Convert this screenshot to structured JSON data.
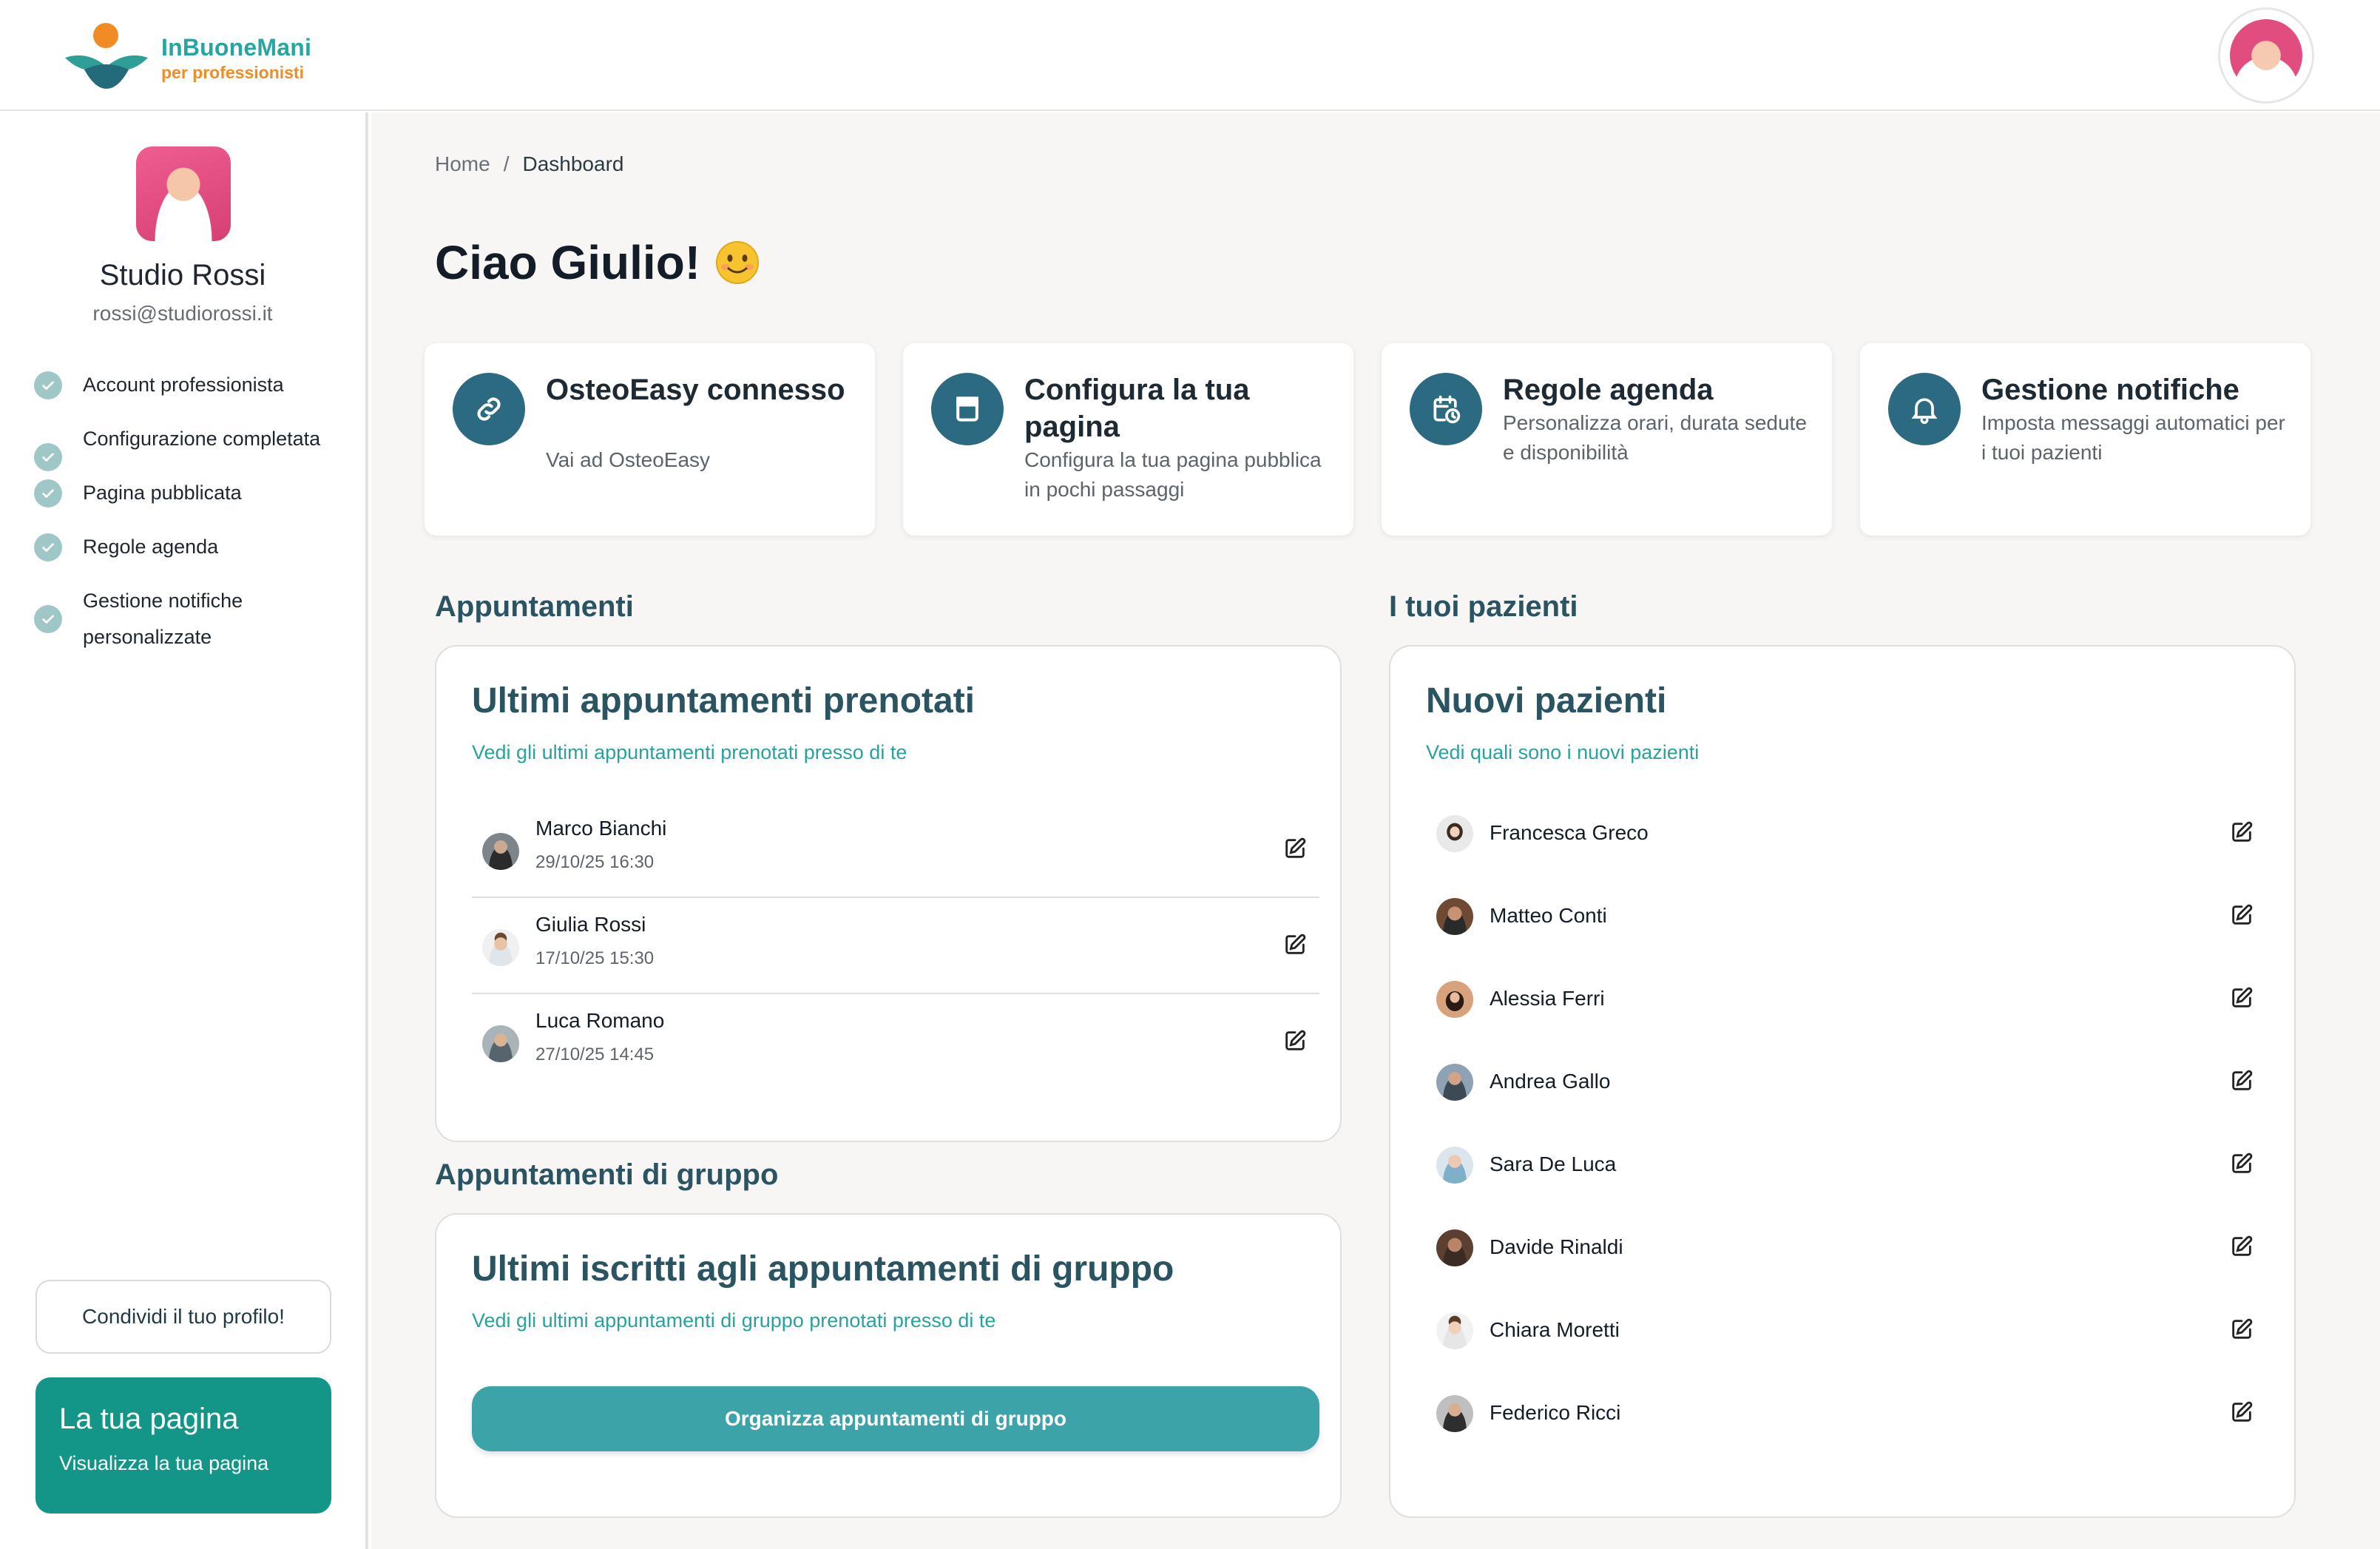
{
  "brand": {
    "name": "InBuoneMani",
    "tagline": "per professionisti"
  },
  "sidebar": {
    "name": "Studio Rossi",
    "email": "rossi@studiorossi.it",
    "checklist": [
      {
        "label": "Account professionista",
        "done": true
      },
      {
        "label": "Configurazione completata",
        "done": true
      },
      {
        "label": "Pagina pubblicata",
        "done": true
      },
      {
        "label": "Regole agenda",
        "done": true
      },
      {
        "label": "Gestione notifiche personalizzate",
        "done": true
      }
    ],
    "share_label": "Condividi il tuo profilo!",
    "page_card": {
      "title": "La tua pagina",
      "subtitle": "Visualizza la tua pagina"
    }
  },
  "breadcrumb": {
    "home": "Home",
    "separator": "/",
    "current": "Dashboard"
  },
  "greeting": "Ciao Giulio!",
  "tiles": [
    {
      "title": "OsteoEasy connesso",
      "subtitle": "Vai ad OsteoEasy",
      "icon": "link-icon"
    },
    {
      "title": "Configura la tua pagina",
      "subtitle": "Configura la tua pagina pubblica in pochi passaggi",
      "icon": "page-icon"
    },
    {
      "title": "Regole agenda",
      "subtitle": "Personalizza orari, durata sedute e disponibilità",
      "icon": "calendar-clock-icon"
    },
    {
      "title": "Gestione notifiche",
      "subtitle": "Imposta messaggi automatici per i tuoi pazienti",
      "icon": "bell-icon"
    }
  ],
  "appointments": {
    "section_title": "Appuntamenti",
    "card_title": "Ultimi appuntamenti prenotati",
    "card_subtitle": "Vedi gli ultimi appuntamenti prenotati presso di te",
    "items": [
      {
        "name": "Marco Bianchi",
        "datetime": "29/10/25 16:30"
      },
      {
        "name": "Giulia Rossi",
        "datetime": "17/10/25 15:30"
      },
      {
        "name": "Luca Romano",
        "datetime": "27/10/25 14:45"
      }
    ]
  },
  "group_appointments": {
    "section_title": "Appuntamenti di gruppo",
    "card_title": "Ultimi iscritti agli appuntamenti di gruppo",
    "card_subtitle": "Vedi gli ultimi appuntamenti di gruppo prenotati presso di te",
    "button_label": "Organizza appuntamenti di gruppo"
  },
  "patients": {
    "section_title": "I tuoi pazienti",
    "card_title": "Nuovi pazienti",
    "card_subtitle": "Vedi quali sono i nuovi pazienti",
    "items": [
      {
        "name": "Francesca Greco"
      },
      {
        "name": "Matteo Conti"
      },
      {
        "name": "Alessia Ferri"
      },
      {
        "name": "Andrea Gallo"
      },
      {
        "name": "Sara De Luca"
      },
      {
        "name": "Davide Rinaldi"
      },
      {
        "name": "Chiara Moretti"
      },
      {
        "name": "Federico Ricci"
      }
    ]
  },
  "colors": {
    "brand_teal": "#25a6a0",
    "brand_orange": "#f08c23",
    "icon_circle": "#2c6a82",
    "accent_green": "#139688",
    "button_teal": "#3ca3a8",
    "heading_teal": "#2a5461"
  }
}
